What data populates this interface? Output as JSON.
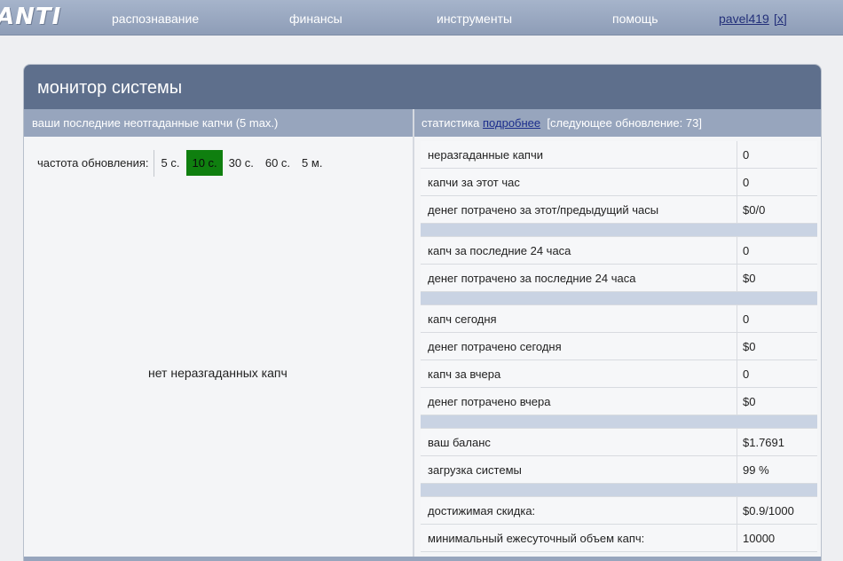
{
  "nav": {
    "logo": "ANTI",
    "items": [
      "распознавание",
      "финансы",
      "инструменты",
      "помощь"
    ],
    "username": "pavel419",
    "logout": "[x]"
  },
  "panel": {
    "title": "монитор системы",
    "left_header": "ваши последние неотгаданные капчи (5 max.)",
    "right_header_prefix": "статистика",
    "right_header_link": "подробнее",
    "right_header_suffix": "[следующее обновление: 73]"
  },
  "refresh": {
    "label": "частота обновления:",
    "options": [
      "5 с.",
      "10 с.",
      "30 с.",
      "60 с.",
      "5 м."
    ],
    "selected": "10 с."
  },
  "empty_message": "нет неразгаданных капч",
  "stats": {
    "group1": [
      {
        "label": "неразгаданные капчи",
        "value": "0"
      },
      {
        "label": "капчи за этот час",
        "value": "0"
      },
      {
        "label": "денег потрачено за этот/предыдущий часы",
        "value": "$0/0"
      }
    ],
    "group2": [
      {
        "label": "капч за последние 24 часа",
        "value": "0"
      },
      {
        "label": "денег потрачено за последние 24 часа",
        "value": "$0"
      }
    ],
    "group3": [
      {
        "label": "капч сегодня",
        "value": "0"
      },
      {
        "label": "денег потрачено сегодня",
        "value": "$0"
      },
      {
        "label": "капч за вчера",
        "value": "0"
      },
      {
        "label": "денег потрачено вчера",
        "value": "$0"
      }
    ],
    "group4": [
      {
        "label": "ваш баланс",
        "value": "$1.7691"
      },
      {
        "label": "загрузка системы",
        "value": "99 %"
      }
    ],
    "group5": [
      {
        "label": "достижимая скидка:",
        "value": "$0.9/1000"
      },
      {
        "label": "минимальный ежесуточный объем капч:",
        "value": "10000"
      }
    ]
  }
}
